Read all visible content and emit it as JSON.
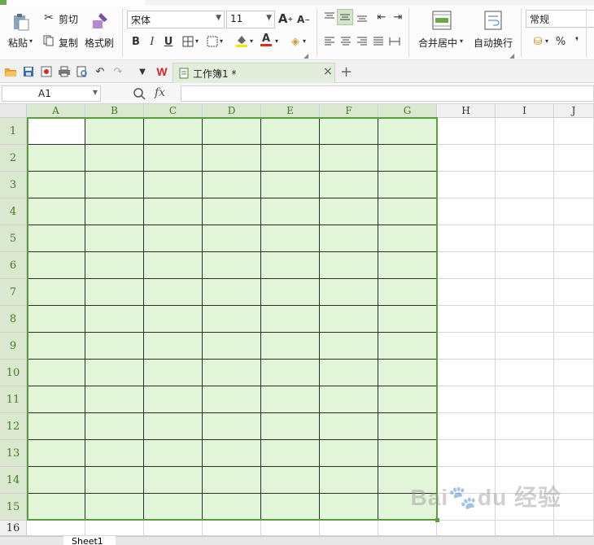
{
  "ribbon": {
    "paste_label": "粘贴",
    "cut_label": "剪切",
    "copy_label": "复制",
    "format_painter_label": "格式刷",
    "font_name": "宋体",
    "font_size": "11",
    "merge_center_label": "合并居中",
    "wrap_text_label": "自动换行",
    "number_format": "常规",
    "percent_symbol": "%",
    "comma_symbol": "❜",
    "bold": "B",
    "italic": "I",
    "underline": "U",
    "font_color_letter": "A",
    "grow_font": "A",
    "shrink_font": "A"
  },
  "doc_tab": {
    "title": "工作簿1 *",
    "close": "×",
    "new": "+"
  },
  "formula_bar": {
    "cell_ref": "A1",
    "fx": "fx",
    "value": ""
  },
  "grid": {
    "columns": [
      "A",
      "B",
      "C",
      "D",
      "E",
      "F",
      "G",
      "H",
      "I",
      "J"
    ],
    "rows": [
      "1",
      "2",
      "3",
      "4",
      "5",
      "6",
      "7",
      "8",
      "9",
      "10",
      "11",
      "12",
      "13",
      "14",
      "15",
      "16"
    ],
    "selected_range": "A1:G15",
    "active_cell": "A1"
  },
  "sheet_tabs": {
    "active": "Sheet1"
  },
  "colors": {
    "selection_border": "#5b9e3c",
    "selection_fill": "#e3f5d8",
    "header_selected": "#d9e8cf",
    "accent": "#6aa84f",
    "wps_red": "#d9262b"
  },
  "icons": [
    "paste-icon",
    "cut-icon",
    "copy-icon",
    "format-painter-icon",
    "open-folder-icon",
    "save-icon",
    "print-icon",
    "undo-icon",
    "redo-icon",
    "wps-logo-icon",
    "document-icon",
    "zoom-search-icon",
    "fx-icon"
  ],
  "watermark": "Bai 经验"
}
